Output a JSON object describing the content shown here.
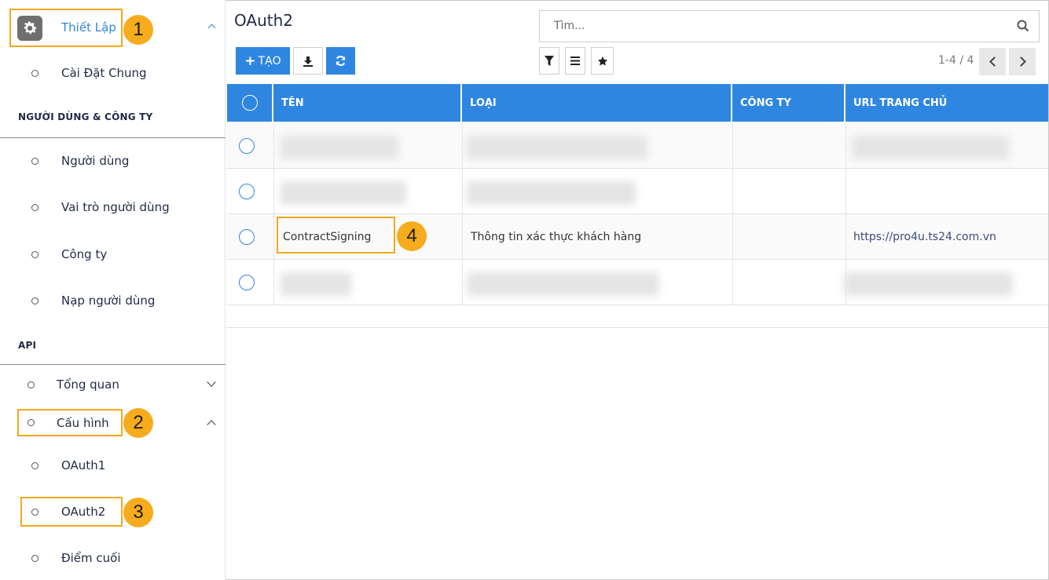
{
  "sidebar": {
    "module": "Thiết Lập",
    "general_settings": "Cài Đặt Chung",
    "section_users": "NGƯỜI DÙNG & CÔNG TY",
    "users": "Người dùng",
    "user_roles": "Vai trò người dùng",
    "companies": "Công ty",
    "import_users": "Nạp người dùng",
    "section_api": "API",
    "overview": "Tổng quan",
    "configuration": "Cấu hình",
    "oauth1": "OAuth1",
    "oauth2": "OAuth2",
    "endpoint": "Điểm cuối"
  },
  "callouts": [
    "1",
    "2",
    "3",
    "4"
  ],
  "header": {
    "title": "OAuth2",
    "search_placeholder": "Tìm...",
    "create_label": "TẠO",
    "pager": "1-4 / 4"
  },
  "table": {
    "columns": [
      "TÊN",
      "LOẠI",
      "CÔNG TY",
      "URL TRANG CHỦ"
    ],
    "visible_row": {
      "name": "ContractSigning",
      "type": "Thông tin xác thực khách hàng",
      "company": "",
      "url": "https://pro4u.ts24.com.vn"
    }
  },
  "colors": {
    "primary": "#2f86e0",
    "callout": "#f6ac1d",
    "gear_bg": "#6f6f6f"
  },
  "icons": {
    "gear": "gear-icon",
    "search": "search-icon",
    "download": "download-icon",
    "refresh": "refresh-icon",
    "filter": "filter-icon",
    "group": "list-icon",
    "favorite": "star-icon"
  }
}
